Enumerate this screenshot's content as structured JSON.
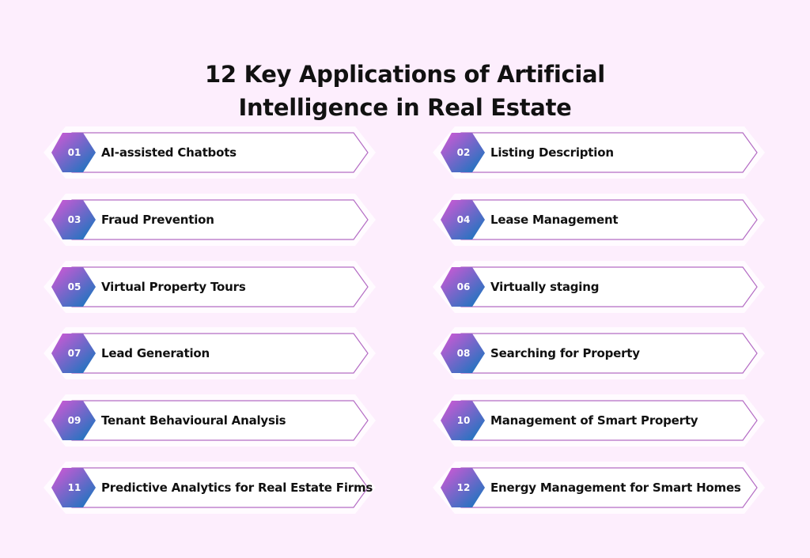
{
  "title": {
    "line1": "12 Key Applications of Artificial",
    "line2": "Intelligence in Real Estate"
  },
  "colors": {
    "background": "#fdeefd",
    "card_border": "#b46cc4",
    "badge_gradient_start": "#d957d6",
    "badge_gradient_end": "#0a78bd"
  },
  "items": [
    {
      "number": "01",
      "label": "AI-assisted Chatbots"
    },
    {
      "number": "02",
      "label": "Listing Description"
    },
    {
      "number": "03",
      "label": "Fraud Prevention"
    },
    {
      "number": "04",
      "label": "Lease Management"
    },
    {
      "number": "05",
      "label": "Virtual Property Tours"
    },
    {
      "number": "06",
      "label": "Virtually staging"
    },
    {
      "number": "07",
      "label": "Lead Generation"
    },
    {
      "number": "08",
      "label": "Searching for Property"
    },
    {
      "number": "09",
      "label": "Tenant Behavioural Analysis"
    },
    {
      "number": "10",
      "label": "Management of Smart Property"
    },
    {
      "number": "11",
      "label": "Predictive Analytics for Real Estate Firms"
    },
    {
      "number": "12",
      "label": "Energy Management for Smart Homes"
    }
  ]
}
